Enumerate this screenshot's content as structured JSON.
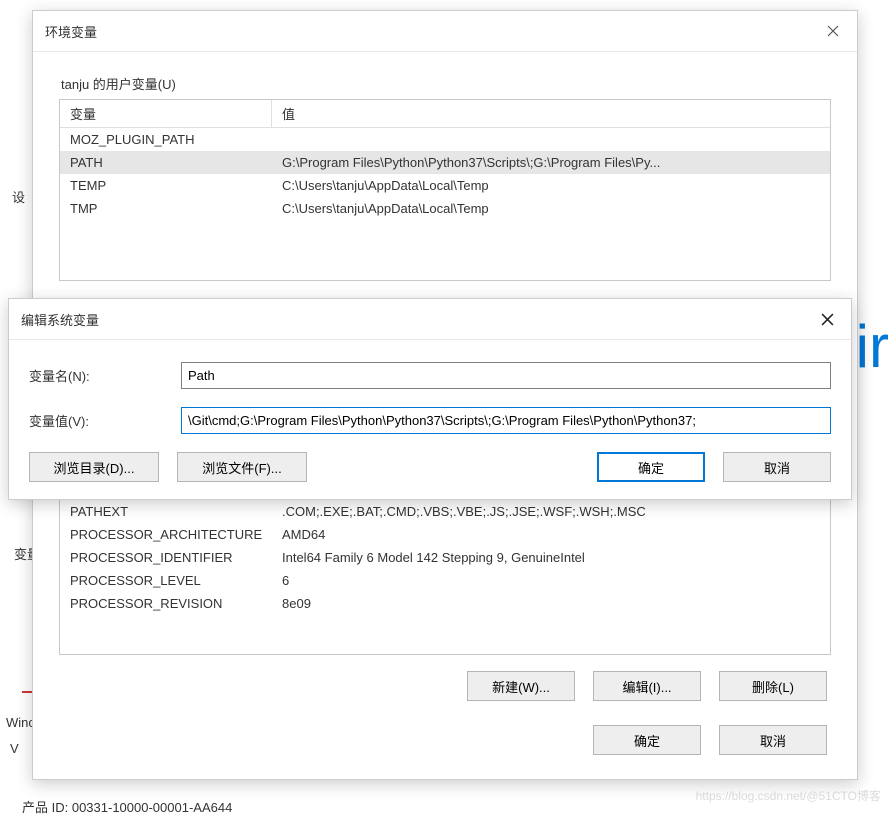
{
  "bg": {
    "settings_label": "设",
    "var_label": "变量",
    "wind": "Winc",
    "w": "V",
    "product_id": "产品 ID: 00331-10000-00001-AA644",
    "win_logo_frag": "/ir",
    "watermark": "https://blog.csdn.net/@51CTO博客"
  },
  "env": {
    "title": "环境变量",
    "user_group": "tanju 的用户变量(U)",
    "cols": {
      "name": "变量",
      "value": "值"
    },
    "user_vars": [
      {
        "name": "MOZ_PLUGIN_PATH",
        "value": ""
      },
      {
        "name": "PATH",
        "value": "G:\\Program Files\\Python\\Python37\\Scripts\\;G:\\Program Files\\Py...",
        "selected": true
      },
      {
        "name": "TEMP",
        "value": "C:\\Users\\tanju\\AppData\\Local\\Temp"
      },
      {
        "name": "TMP",
        "value": "C:\\Users\\tanju\\AppData\\Local\\Temp"
      }
    ],
    "sys_vars": [
      {
        "name": "PATHEXT",
        "value": ".COM;.EXE;.BAT;.CMD;.VBS;.VBE;.JS;.JSE;.WSF;.WSH;.MSC"
      },
      {
        "name": "PROCESSOR_ARCHITECTURE",
        "value": "AMD64"
      },
      {
        "name": "PROCESSOR_IDENTIFIER",
        "value": "Intel64 Family 6 Model 142 Stepping 9, GenuineIntel"
      },
      {
        "name": "PROCESSOR_LEVEL",
        "value": "6"
      },
      {
        "name": "PROCESSOR_REVISION",
        "value": "8e09"
      }
    ],
    "btn_new": "新建(W)...",
    "btn_edit": "编辑(I)...",
    "btn_del": "删除(L)",
    "btn_ok": "确定",
    "btn_cancel": "取消"
  },
  "edit": {
    "title": "编辑系统变量",
    "name_label": "变量名(N):",
    "value_label": "变量值(V):",
    "name_value": "Path",
    "value_value": "\\Git\\cmd;G:\\Program Files\\Python\\Python37\\Scripts\\;G:\\Program Files\\Python\\Python37;",
    "btn_browse_dir": "浏览目录(D)...",
    "btn_browse_file": "浏览文件(F)...",
    "btn_ok": "确定",
    "btn_cancel": "取消"
  }
}
